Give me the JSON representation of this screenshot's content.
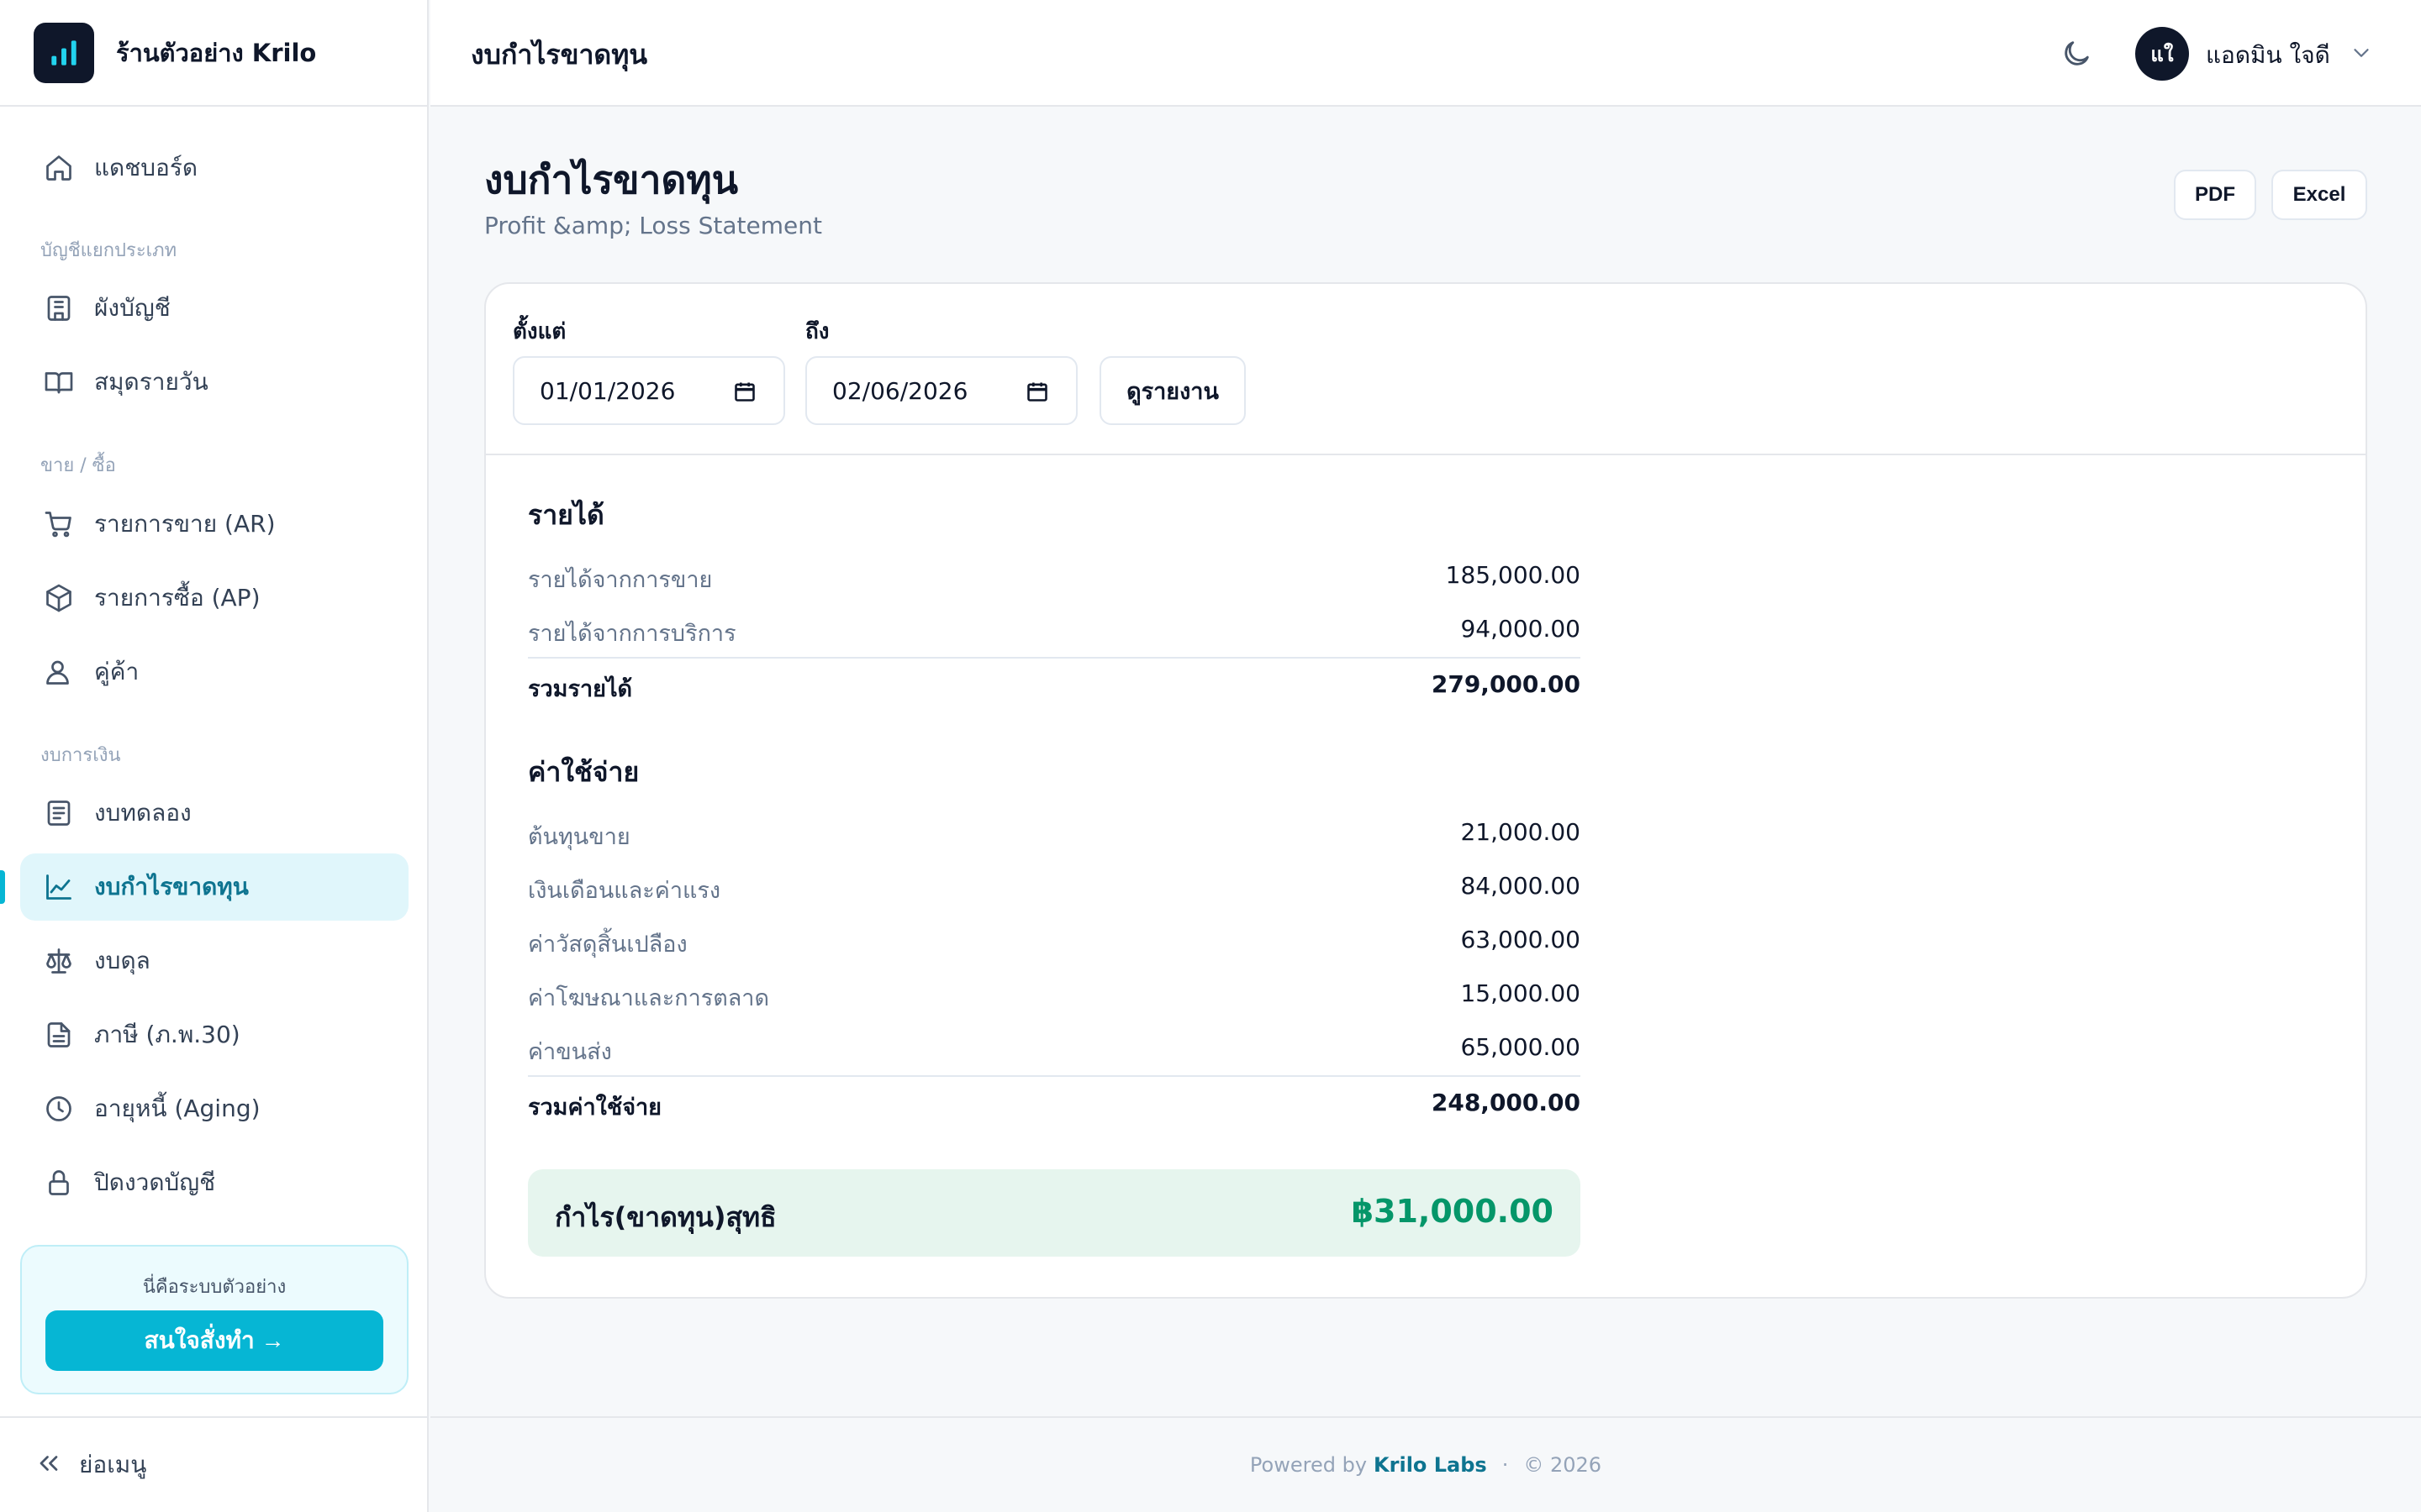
{
  "brand": {
    "name": "ร้านตัวอย่าง Krilo"
  },
  "sidebar": {
    "dashboard": "แดชบอร์ด",
    "section_ledger": "บัญชีแยกประเภท",
    "chart_of_accounts": "ผังบัญชี",
    "journal": "สมุดรายวัน",
    "section_trade": "ขาย / ซื้อ",
    "sales_ar": "รายการขาย (AR)",
    "purchases_ap": "รายการซื้อ (AP)",
    "partners": "คู่ค้า",
    "section_financial": "งบการเงิน",
    "trial_balance": "งบทดลอง",
    "profit_loss": "งบกำไรขาดทุน",
    "balance_sheet": "งบดุล",
    "tax": "ภาษี (ภ.พ.30)",
    "aging": "อายุหนี้ (Aging)",
    "close_period": "ปิดงวดบัญชี",
    "promo_text": "นี่คือระบบตัวอย่าง",
    "promo_button": "สนใจสั่งทำ →",
    "collapse": "ย่อเมนู"
  },
  "topbar": {
    "title": "งบกำไรขาดทุน",
    "avatar_initials": "แใ",
    "user_name": "แอดมิน ใจดี"
  },
  "page": {
    "title": "งบกำไรขาดทุน",
    "subtitle": "Profit &amp; Loss Statement",
    "pdf_button": "PDF",
    "excel_button": "Excel"
  },
  "filter": {
    "from_label": "ตั้งแต่",
    "from_value": "01/01/2026",
    "to_label": "ถึง",
    "to_value": "02/06/2026",
    "run_button": "ดูรายงาน"
  },
  "report": {
    "revenue_heading": "รายได้",
    "revenue_items": [
      {
        "name": "รายได้จากการขาย",
        "amount": "185,000.00"
      },
      {
        "name": "รายได้จากการบริการ",
        "amount": "94,000.00"
      }
    ],
    "revenue_total_label": "รวมรายได้",
    "revenue_total": "279,000.00",
    "expense_heading": "ค่าใช้จ่าย",
    "expense_items": [
      {
        "name": "ต้นทุนขาย",
        "amount": "21,000.00"
      },
      {
        "name": "เงินเดือนและค่าแรง",
        "amount": "84,000.00"
      },
      {
        "name": "ค่าวัสดุสิ้นเปลือง",
        "amount": "63,000.00"
      },
      {
        "name": "ค่าโฆษณาและการตลาด",
        "amount": "15,000.00"
      },
      {
        "name": "ค่าขนส่ง",
        "amount": "65,000.00"
      }
    ],
    "expense_total_label": "รวมค่าใช้จ่าย",
    "expense_total": "248,000.00",
    "net_label": "กำไร(ขาดทุน)สุทธิ",
    "net_amount": "฿31,000.00"
  },
  "footer": {
    "powered_by": "Powered by",
    "company": "Krilo Labs",
    "separator": "·",
    "copyright": "© 2026"
  },
  "colors": {
    "accent": "#06b6d4",
    "active_bg": "#e0f6fb",
    "active_text": "#0e7490",
    "net_profit": "#059669",
    "net_bg": "#e6f5ee",
    "dark": "#0f172a"
  }
}
